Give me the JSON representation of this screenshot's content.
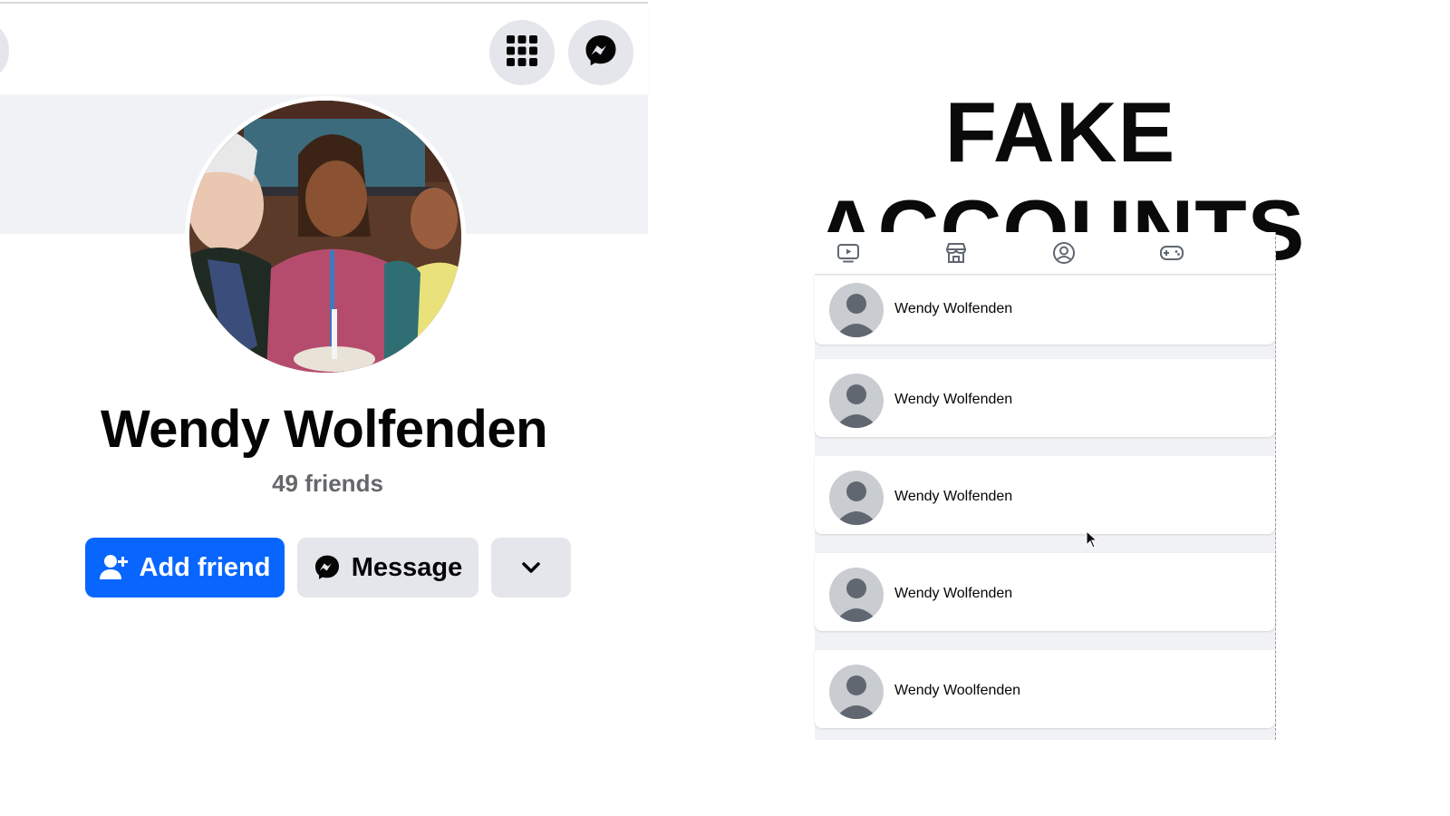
{
  "profile": {
    "name": "Wendy Wolfenden",
    "friends_count": "49 friends",
    "buttons": {
      "add_friend": "Add friend",
      "message": "Message"
    },
    "colors": {
      "primary": "#0866ff",
      "secondary_bg": "#e4e6eb"
    }
  },
  "topbar": {
    "icons": [
      "menu-grid-icon",
      "messenger-icon"
    ]
  },
  "headline": "FAKE ACCOUNTS",
  "search_results": {
    "tabs": [
      "watch-icon",
      "marketplace-icon",
      "profile-icon",
      "gaming-icon"
    ],
    "items": [
      {
        "name": "Wendy Wolfenden"
      },
      {
        "name": "Wendy Wolfenden"
      },
      {
        "name": "Wendy Wolfenden"
      },
      {
        "name": "Wendy Wolfenden"
      },
      {
        "name": "Wendy Woolfenden"
      }
    ]
  }
}
